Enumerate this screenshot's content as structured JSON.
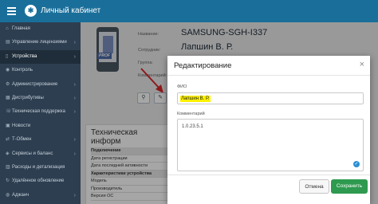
{
  "topbar": {
    "title": "Личный кабинет"
  },
  "sidebar": {
    "items": [
      {
        "label": "Главная",
        "icon": "home-icon",
        "glyph": "⌂",
        "chevron": false,
        "active": false
      },
      {
        "label": "Управление лицензиями",
        "icon": "license-icon",
        "glyph": "▤",
        "chevron": true,
        "active": false
      },
      {
        "label": "Устройства",
        "icon": "devices-icon",
        "glyph": "▯",
        "chevron": true,
        "active": true
      },
      {
        "label": "Контроль",
        "icon": "control-icon",
        "glyph": "◉",
        "chevron": false,
        "active": false
      },
      {
        "label": "Администрирование",
        "icon": "admin-icon",
        "glyph": "⚙",
        "chevron": true,
        "active": false
      },
      {
        "label": "Дистрибутивы",
        "icon": "distrib-icon",
        "glyph": "▦",
        "chevron": true,
        "active": false
      },
      {
        "label": "Техническая поддержка",
        "icon": "support-icon",
        "glyph": "☏",
        "chevron": true,
        "active": false
      },
      {
        "label": "Новости",
        "icon": "news-icon",
        "glyph": "▣",
        "chevron": false,
        "active": false
      },
      {
        "label": "Т-Обмен",
        "icon": "exchange-icon",
        "glyph": "⇄",
        "chevron": true,
        "active": false
      },
      {
        "label": "Сервисы и баланс",
        "icon": "services-icon",
        "glyph": "◈",
        "chevron": true,
        "active": false
      },
      {
        "label": "Расходы и детализация",
        "icon": "expenses-icon",
        "glyph": "▥",
        "chevron": false,
        "active": false
      },
      {
        "label": "Удалённое обновление",
        "icon": "update-icon",
        "glyph": "↻",
        "chevron": false,
        "active": false
      },
      {
        "label": "Аджанч",
        "icon": "agent-icon",
        "glyph": "◍",
        "chevron": true,
        "active": false
      }
    ]
  },
  "device": {
    "badge": "PROF",
    "name_label": "Название:",
    "name_value": "SAMSUNG-SGH-I337",
    "user_label": "Сотрудник:",
    "user_value": "Лапшин В. Р.",
    "group_label": "Группа:",
    "comment_label": "Комментарий:"
  },
  "tech": {
    "title": "Техническая информ",
    "rows": [
      {
        "text": "Подключение",
        "head": true
      },
      {
        "text": "Дата регистрации",
        "head": false
      },
      {
        "text": "Дата последней активности",
        "head": false
      },
      {
        "text": "Характеристики устройства",
        "head": true
      },
      {
        "text": "Модель",
        "head": false
      },
      {
        "text": "Производитель",
        "head": false
      },
      {
        "text": "Версия ОС",
        "head": false
      }
    ]
  },
  "modal": {
    "title": "Редактирование",
    "close": "×",
    "fio_label": "ФИО",
    "fio_value": "Лапшин В. Р.",
    "comment_label": "Комментарий",
    "comment_value": "1.0.23.5.1",
    "cancel_label": "Отмена",
    "save_label": "Сохранить"
  },
  "colors": {
    "topbar": "#1a6f9a",
    "sidebar": "#2d3e50",
    "save_button": "#2e9a4f",
    "highlight": "#fff200",
    "arrow": "#d9262a"
  }
}
